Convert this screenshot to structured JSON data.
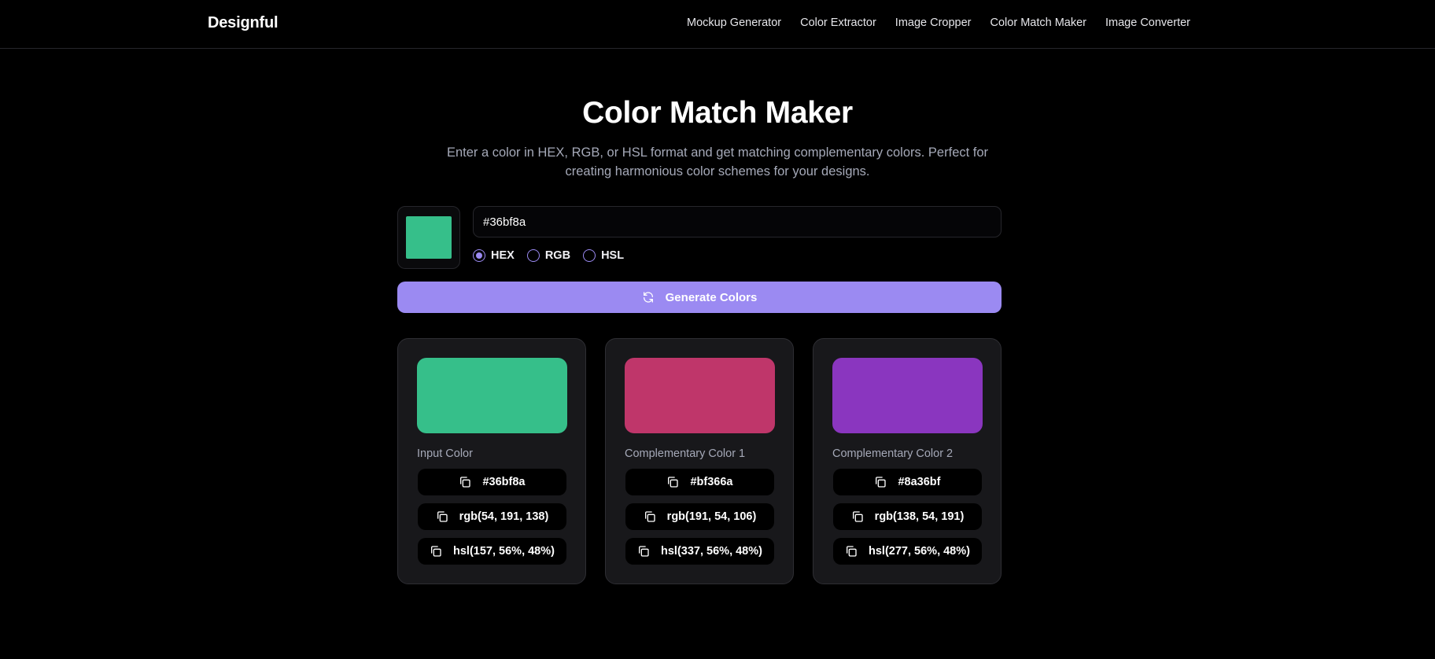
{
  "header": {
    "brand": "Designful",
    "nav": [
      "Mockup Generator",
      "Color Extractor",
      "Image Cropper",
      "Color Match Maker",
      "Image Converter"
    ]
  },
  "hero": {
    "title": "Color Match Maker",
    "subtitle": "Enter a color in HEX, RGB, or HSL format and get matching complementary colors. Perfect for creating harmonious color schemes for your designs."
  },
  "form": {
    "input_value": "#36bf8a",
    "preview_color": "#36bf8a",
    "formats": [
      {
        "label": "HEX",
        "selected": true
      },
      {
        "label": "RGB",
        "selected": false
      },
      {
        "label": "HSL",
        "selected": false
      }
    ],
    "generate_label": "Generate Colors",
    "icon": "refresh-icon"
  },
  "cards": [
    {
      "name": "Input Color",
      "color": "#36bf8a",
      "hex": "#36bf8a",
      "rgb": "rgb(54, 191, 138)",
      "hsl": "hsl(157, 56%, 48%)"
    },
    {
      "name": "Complementary Color 1",
      "color": "#bf366a",
      "hex": "#bf366a",
      "rgb": "rgb(191, 54, 106)",
      "hsl": "hsl(337, 56%, 48%)"
    },
    {
      "name": "Complementary Color 2",
      "color": "#8a36bf",
      "hex": "#8a36bf",
      "rgb": "rgb(138, 54, 191)",
      "hsl": "hsl(277, 56%, 48%)"
    }
  ],
  "theme": {
    "accent": "#9b8af2",
    "background": "#000000",
    "card": "#18181b"
  }
}
